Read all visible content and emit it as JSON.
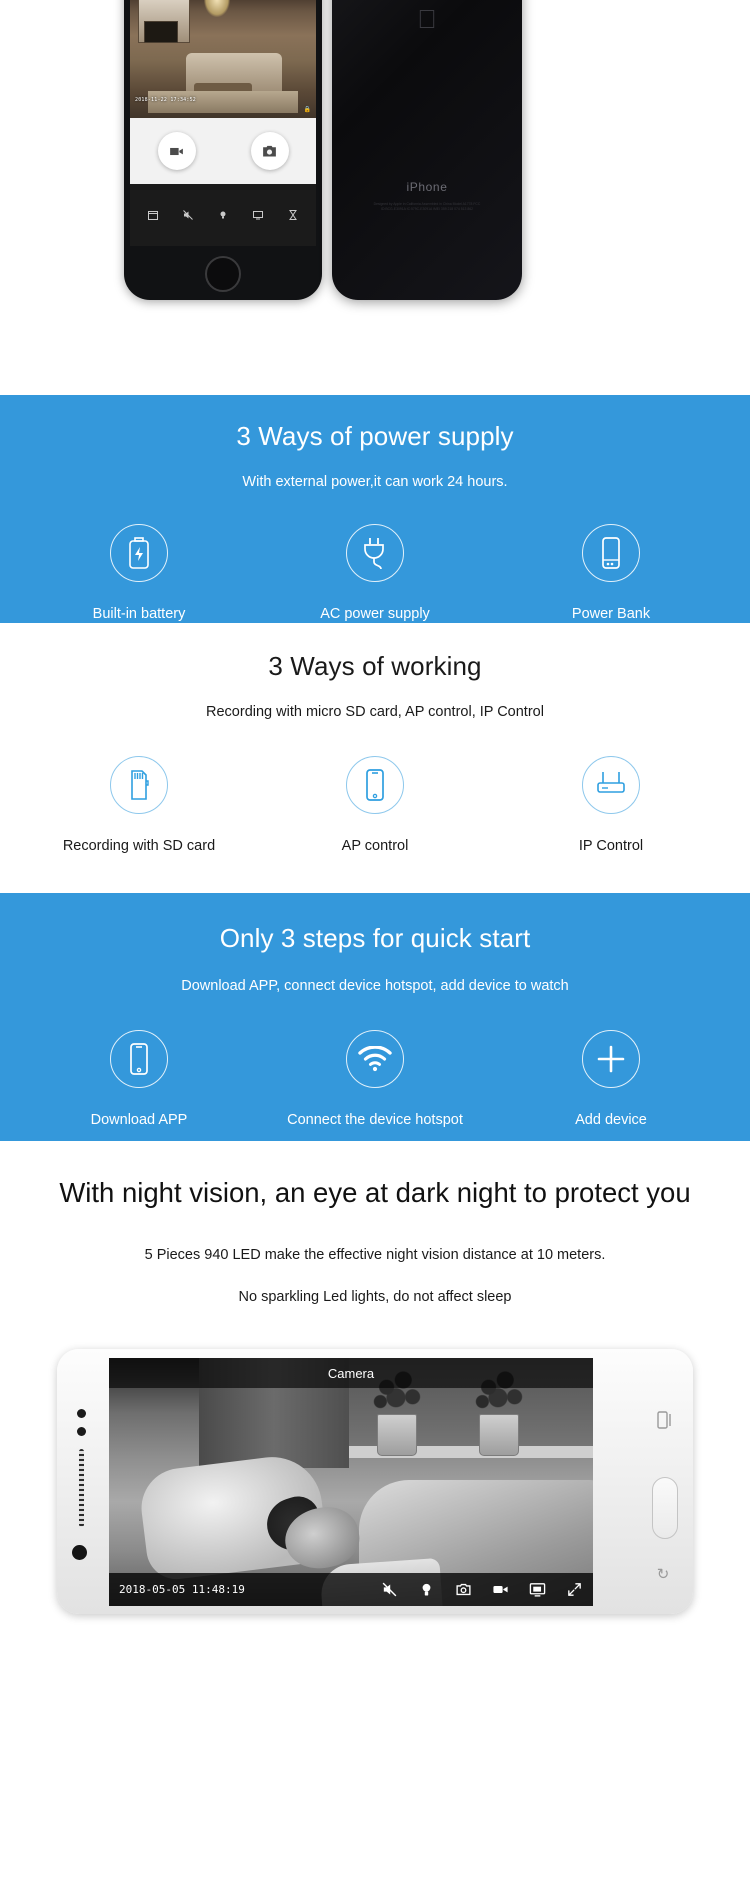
{
  "hero": {
    "phone_front": {
      "timestamp": "2018-11-22 17:34:52",
      "lock_icon": "lock-icon",
      "record_button": "video-record-button",
      "snapshot_button": "camera-snapshot-button",
      "tabs": [
        {
          "name": "calendar-playback-icon"
        },
        {
          "name": "mute-speaker-icon"
        },
        {
          "name": "light-bulb-icon"
        },
        {
          "name": "screen-monitor-icon"
        },
        {
          "name": "hourglass-icon"
        }
      ]
    },
    "phone_back": {
      "brand": "iPhone",
      "fine_print": "Designed by Apple in California Assembled in China Model A1778 FCC ID:BCG-E3091A IC:579C-E3091A IMEI 359 218 074 513 862"
    }
  },
  "sections": [
    {
      "id": "power-supply",
      "theme": "blue",
      "title": "3 Ways of power supply",
      "subtitle": "With external power,it can work 24 hours.",
      "items": [
        {
          "icon": "battery-icon",
          "label": "Built-in battery"
        },
        {
          "icon": "ac-plug-icon",
          "label": "AC power supply"
        },
        {
          "icon": "power-bank-icon",
          "label": "Power Bank"
        }
      ]
    },
    {
      "id": "ways-of-working",
      "theme": "white",
      "title": "3 Ways of working",
      "subtitle": "Recording with micro SD card,  AP control,  IP Control",
      "items": [
        {
          "icon": "sd-card-icon",
          "label": "Recording with SD card"
        },
        {
          "icon": "smartphone-icon",
          "label": "AP control"
        },
        {
          "icon": "router-icon",
          "label": "IP Control"
        }
      ]
    },
    {
      "id": "quick-start",
      "theme": "blue",
      "title": "Only 3 steps for quick start",
      "subtitle": "Download APP, connect device hotspot, add device to watch",
      "items": [
        {
          "icon": "smartphone-icon",
          "label": "Download APP"
        },
        {
          "icon": "wifi-icon",
          "label": "Connect the device hotspot"
        },
        {
          "icon": "plus-icon",
          "label": "Add device"
        }
      ]
    }
  ],
  "night_vision": {
    "title": "With night vision, an eye at dark night to protect you",
    "line1": "5 Pieces 940 LED make the effective night vision distance at 10 meters.",
    "line2": "No sparkling Led lights, do not affect sleep",
    "preview": {
      "topbar_label": "Camera",
      "timestamp": "2018-05-05  11:48:19",
      "toolbar": [
        {
          "name": "mute-speaker-icon"
        },
        {
          "name": "light-bulb-icon"
        },
        {
          "name": "camera-snapshot-icon"
        },
        {
          "name": "video-record-icon"
        },
        {
          "name": "screen-monitor-icon"
        },
        {
          "name": "fullscreen-expand-icon"
        }
      ]
    }
  },
  "colors": {
    "brand_blue": "#3498db",
    "icon_blue": "#2f9fe0",
    "white": "#ffffff",
    "text_dark": "#1a1a1a"
  }
}
